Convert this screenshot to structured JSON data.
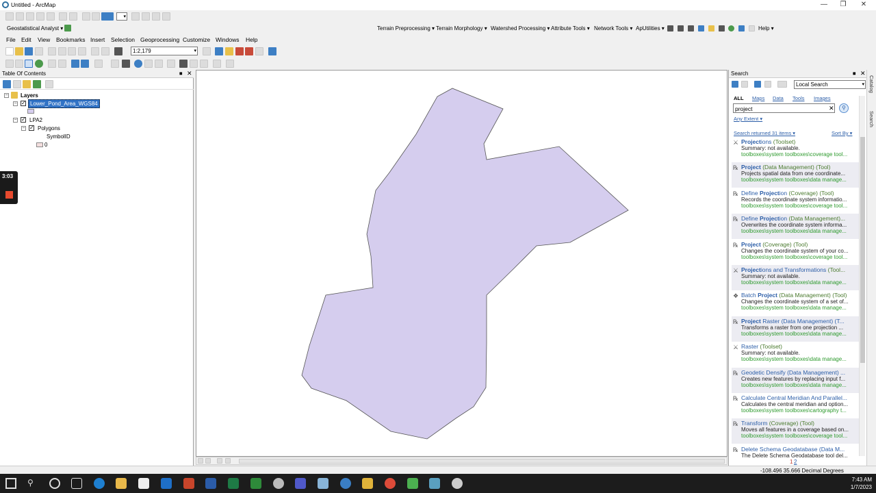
{
  "window": {
    "title": "Untitled - ArcMap"
  },
  "toolbar_top": {
    "geostat": "Geostatistical Analyst ▾",
    "extensions": [
      "Terrain Preprocessing ▾",
      "Terrain Morphology ▾",
      "Watershed Processing ▾",
      "Attribute Tools ▾",
      "Network Tools ▾",
      "ApUtilities ▾"
    ],
    "help": "Help ▾"
  },
  "menu": [
    "File",
    "Edit",
    "View",
    "Bookmarks",
    "Insert",
    "Selection",
    "Geoprocessing",
    "Customize",
    "Windows",
    "Help"
  ],
  "scale": {
    "value": "1:2,179"
  },
  "toc": {
    "title": "Table Of Contents",
    "layers_label": "Layers",
    "layer1": "Lower_Pond_Area_WGS84",
    "layer2": "LPA2",
    "polygons": "Polygons",
    "symbol_field": "SymbolID",
    "symbol_value": "0"
  },
  "recorder": {
    "time": "3:03"
  },
  "search": {
    "title": "Search",
    "scope": "Local Search",
    "filters": {
      "all": "ALL",
      "maps": "Maps",
      "data": "Data",
      "tools": "Tools",
      "images": "Images"
    },
    "query": "project",
    "extent": "Any Extent ▾",
    "returned": "Search returned 31 items ▾",
    "sort": "Sort By ▾",
    "results": [
      {
        "pre": "",
        "bold": "Project",
        "post": "ions",
        "cat": " (Toolset)",
        "desc": "Summary: not available.",
        "path": "toolboxes\\system toolboxes\\coverage tool..."
      },
      {
        "pre": "",
        "bold": "Project",
        "post": "",
        "cat": " (Data Management) (Tool)",
        "desc": "Projects spatial data from one coordinate...",
        "path": "toolboxes\\system toolboxes\\data manage..."
      },
      {
        "pre": "Define ",
        "bold": "Project",
        "post": "ion",
        "cat": " (Coverage) (Tool)",
        "desc": "Records the coordinate system informatio...",
        "path": "toolboxes\\system toolboxes\\coverage tool..."
      },
      {
        "pre": "Define ",
        "bold": "Project",
        "post": "ion",
        "cat": " (Data Management)...",
        "desc": "Overwrites the coordinate system informa...",
        "path": "toolboxes\\system toolboxes\\data manage..."
      },
      {
        "pre": "",
        "bold": "Project",
        "post": "",
        "cat": " (Coverage) (Tool)",
        "desc": "Changes the coordinate system of your co...",
        "path": "toolboxes\\system toolboxes\\coverage tool..."
      },
      {
        "pre": "",
        "bold": "Project",
        "post": "ions and Transformations",
        "cat": " (Tool...",
        "desc": "Summary: not available.",
        "path": "toolboxes\\system toolboxes\\data manage..."
      },
      {
        "pre": "Batch ",
        "bold": "Project",
        "post": "",
        "cat": " (Data Management) (Tool)",
        "desc": "Changes the coordinate system of a set of...",
        "path": "toolboxes\\system toolboxes\\data manage..."
      },
      {
        "pre": "",
        "bold": "Project",
        "post": " Raster (Data Management) (T...",
        "cat": "",
        "desc": "Transforms a raster from one projection ...",
        "path": "toolboxes\\system toolboxes\\data manage..."
      },
      {
        "pre": "Raster",
        "bold": "",
        "post": "",
        "cat": " (Toolset)",
        "desc": "Summary: not available.",
        "path": "toolboxes\\system toolboxes\\data manage..."
      },
      {
        "pre": "Geodetic Densify (Data Management) ...",
        "bold": "",
        "post": "",
        "cat": "",
        "desc": "Creates new features by replacing input f...",
        "path": "toolboxes\\system toolboxes\\data manage..."
      },
      {
        "pre": "Calculate Central Meridian And Parallel...",
        "bold": "",
        "post": "",
        "cat": "",
        "desc": "Calculates the central meridian and option...",
        "path": "toolboxes\\system toolboxes\\cartography t..."
      },
      {
        "pre": "Transform",
        "bold": "",
        "post": "",
        "cat": " (Coverage) (Tool)",
        "desc": "Moves all features in a coverage based on...",
        "path": "toolboxes\\system toolboxes\\coverage tool..."
      },
      {
        "pre": "Delete Schema Geodatabase (Data M...",
        "bold": "",
        "post": "",
        "cat": "",
        "desc": "The Delete Schema Geodatabase tool del...",
        "path": ""
      }
    ],
    "pages": {
      "p1": "1",
      "p2": "2"
    }
  },
  "side_tabs": {
    "catalog": "Catalog",
    "search": "Search"
  },
  "status": {
    "coords": "-108.496  35.666 Decimal Degrees"
  },
  "taskbar": {
    "time": "7:43 AM",
    "date": "1/7/2023"
  },
  "colors": {
    "polygon_fill": "#d5cdee",
    "polygon_stroke": "#555",
    "selection": "#3173c6",
    "link": "#2c5ea8",
    "path_green": "#2e9a2e"
  }
}
